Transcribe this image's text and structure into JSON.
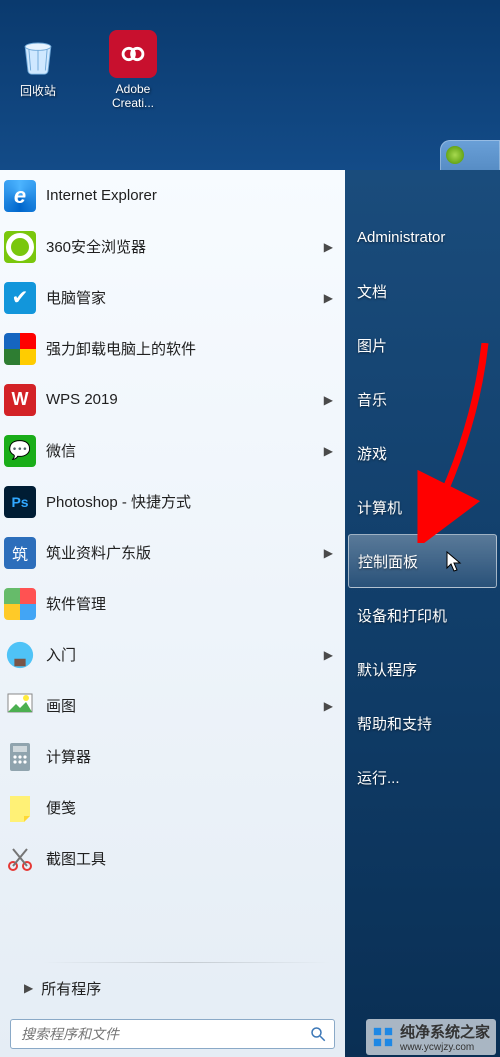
{
  "desktop": {
    "icons": {
      "recycle": "回收站",
      "adobe": "Adobe Creati..."
    }
  },
  "start": {
    "left_items": [
      {
        "key": "ie",
        "label": "Internet Explorer",
        "has_submenu": false
      },
      {
        "key": "browser360",
        "label": "360安全浏览器",
        "has_submenu": true
      },
      {
        "key": "guanjia",
        "label": "电脑管家",
        "has_submenu": true
      },
      {
        "key": "uninstall",
        "label": "强力卸载电脑上的软件",
        "has_submenu": false
      },
      {
        "key": "wps",
        "label": "WPS 2019",
        "has_submenu": true
      },
      {
        "key": "wechat",
        "label": "微信",
        "has_submenu": true
      },
      {
        "key": "ps",
        "label": "Photoshop - 快捷方式",
        "has_submenu": false
      },
      {
        "key": "zhuye",
        "label": "筑业资料广东版",
        "has_submenu": true
      },
      {
        "key": "softmgr",
        "label": "软件管理",
        "has_submenu": false
      },
      {
        "key": "getstarted",
        "label": "入门",
        "has_submenu": true
      },
      {
        "key": "paint",
        "label": "画图",
        "has_submenu": true
      },
      {
        "key": "calc",
        "label": "计算器",
        "has_submenu": false
      },
      {
        "key": "sticky",
        "label": "便笺",
        "has_submenu": false
      },
      {
        "key": "snip",
        "label": "截图工具",
        "has_submenu": false
      }
    ],
    "all_programs": "所有程序",
    "search_placeholder": "搜索程序和文件",
    "right_items": [
      {
        "key": "admin",
        "label": "Administrator"
      },
      {
        "key": "docs",
        "label": "文档"
      },
      {
        "key": "pics",
        "label": "图片"
      },
      {
        "key": "music",
        "label": "音乐"
      },
      {
        "key": "games",
        "label": "游戏"
      },
      {
        "key": "computer",
        "label": "计算机"
      },
      {
        "key": "control",
        "label": "控制面板",
        "selected": true
      },
      {
        "key": "devices",
        "label": "设备和打印机"
      },
      {
        "key": "default",
        "label": "默认程序"
      },
      {
        "key": "help",
        "label": "帮助和支持"
      },
      {
        "key": "run",
        "label": "运行..."
      }
    ]
  },
  "watermark": {
    "text": "纯净系统之家",
    "url": "www.ycwjzy.com"
  },
  "colors": {
    "highlight": "#ff0000",
    "desktop_blue_top": "#0a3a6e",
    "desktop_blue_bot": "#3e8fcf"
  }
}
